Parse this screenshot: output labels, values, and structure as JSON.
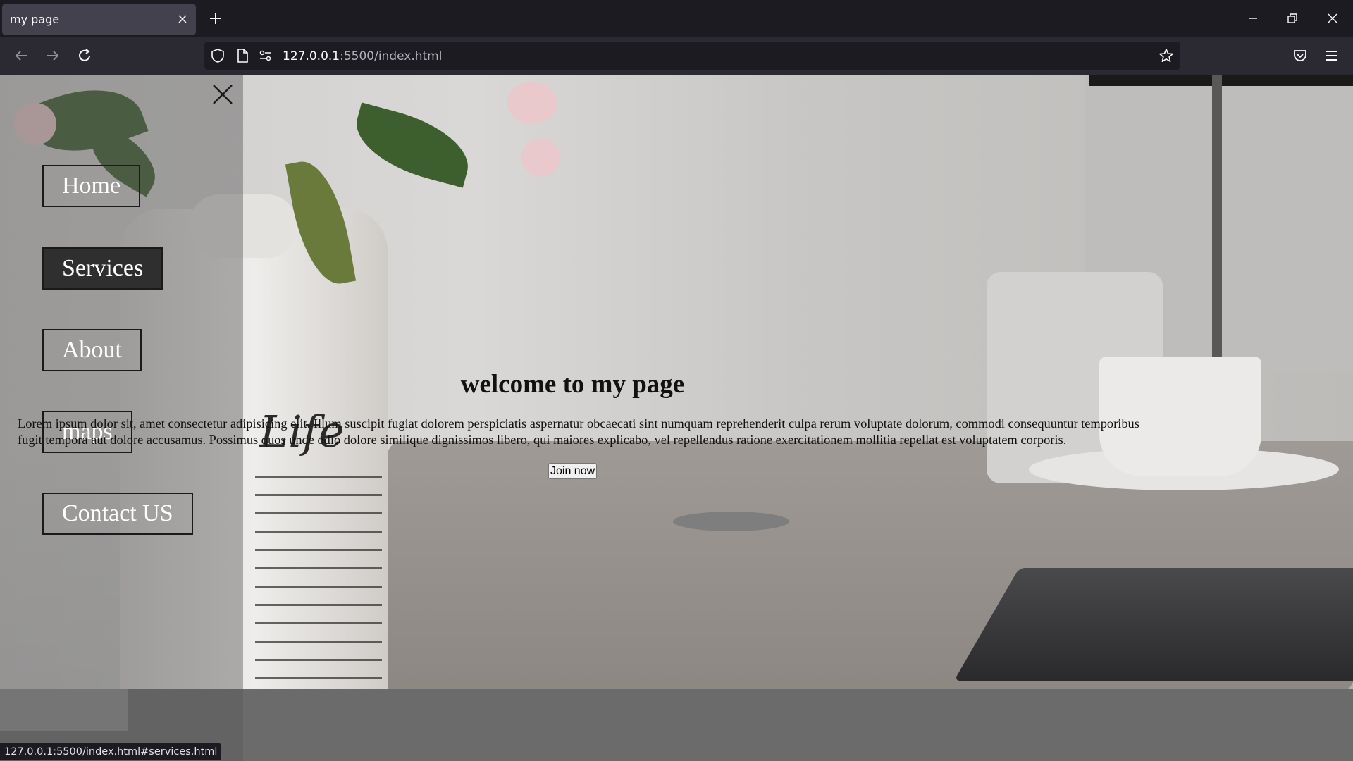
{
  "browser": {
    "tab_title": "my page",
    "url_host": "127.0.0.1",
    "url_rest": ":5500/index.html",
    "status_text": "127.0.0.1:5500/index.html#services.html"
  },
  "sidebar": {
    "items": [
      {
        "label": "Home",
        "active": false
      },
      {
        "label": "Services",
        "active": true
      },
      {
        "label": "About",
        "active": false
      },
      {
        "label": "maps",
        "active": false
      },
      {
        "label": "Contact US",
        "active": false
      }
    ]
  },
  "main": {
    "heading": "welcome to my page",
    "paragraph": "Lorem ipsum dolor sit, amet consectetur adipisicing elit. Illum suscipit fugiat dolorem perspiciatis aspernatur obcaecati sint numquam reprehenderit culpa rerum voluptate dolorum, commodi consequuntur temporibus fugit tempora aut dolore accusamus. Possimus quos unde odio dolore similique dignissimos libero, qui maiores explicabo, vel repellendus ratione exercitationem mollitia repellat est voluptatem corporis.",
    "join_label": "Join now"
  },
  "decor": {
    "vase_word": "Life"
  }
}
